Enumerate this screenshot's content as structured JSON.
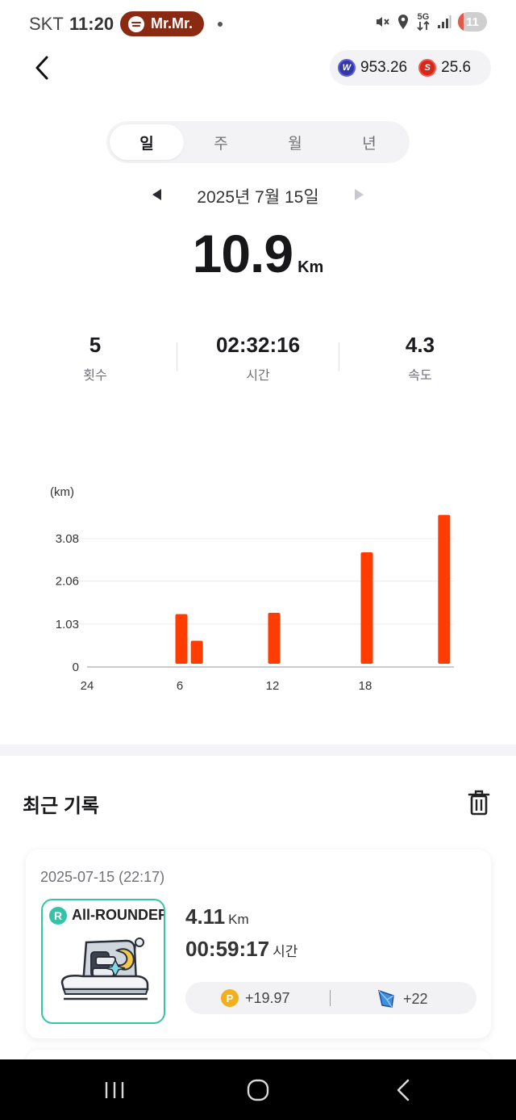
{
  "status_bar": {
    "carrier": "SKT",
    "time": "11:20",
    "media_pill": "Mr.Mr.",
    "network": "5G",
    "battery": "11"
  },
  "header": {
    "balance_w": "953.26",
    "balance_s": "25.6"
  },
  "tabs": [
    {
      "label": "일",
      "active": true
    },
    {
      "label": "주",
      "active": false
    },
    {
      "label": "월",
      "active": false
    },
    {
      "label": "년",
      "active": false
    }
  ],
  "date": {
    "label": "2025년 7월 15일"
  },
  "summary": {
    "distance": "10.9",
    "distance_unit": "Km"
  },
  "stats": [
    {
      "value": "5",
      "label": "횟수"
    },
    {
      "value": "02:32:16",
      "label": "시간"
    },
    {
      "value": "4.3",
      "label": "속도"
    }
  ],
  "chart_data": {
    "type": "bar",
    "ylabel": "(km)",
    "ylim": [
      0,
      3.08
    ],
    "y_ticks": [
      "3.08",
      "2.06",
      "1.03",
      "0"
    ],
    "y_tick_values": [
      3.08,
      2.06,
      1.03,
      0
    ],
    "x_tick_labels": [
      "24",
      "6",
      "12",
      "18"
    ],
    "x_tick_hours": [
      0,
      6,
      12,
      18
    ],
    "x_range": [
      0,
      24
    ],
    "hours": [
      6,
      7,
      12,
      18,
      23
    ],
    "values": [
      1.27,
      0.63,
      1.3,
      2.75,
      3.65
    ],
    "bar_color": "#ff3d00",
    "grid": true
  },
  "recent": {
    "title": "최근 기록",
    "record": {
      "date": "2025-07-15 (22:17)",
      "shoe_grade": "R",
      "shoe_name": "All-ROUNDER",
      "distance": "4.11",
      "distance_unit": "Km",
      "time": "00:59:17",
      "time_unit": "시간",
      "reward_points": "+19.97",
      "reward_gems": "+22"
    }
  },
  "colors": {
    "accent": "#ff3d00",
    "shoe_border": "#34c3a6",
    "point_coin": "#f2b11c"
  }
}
